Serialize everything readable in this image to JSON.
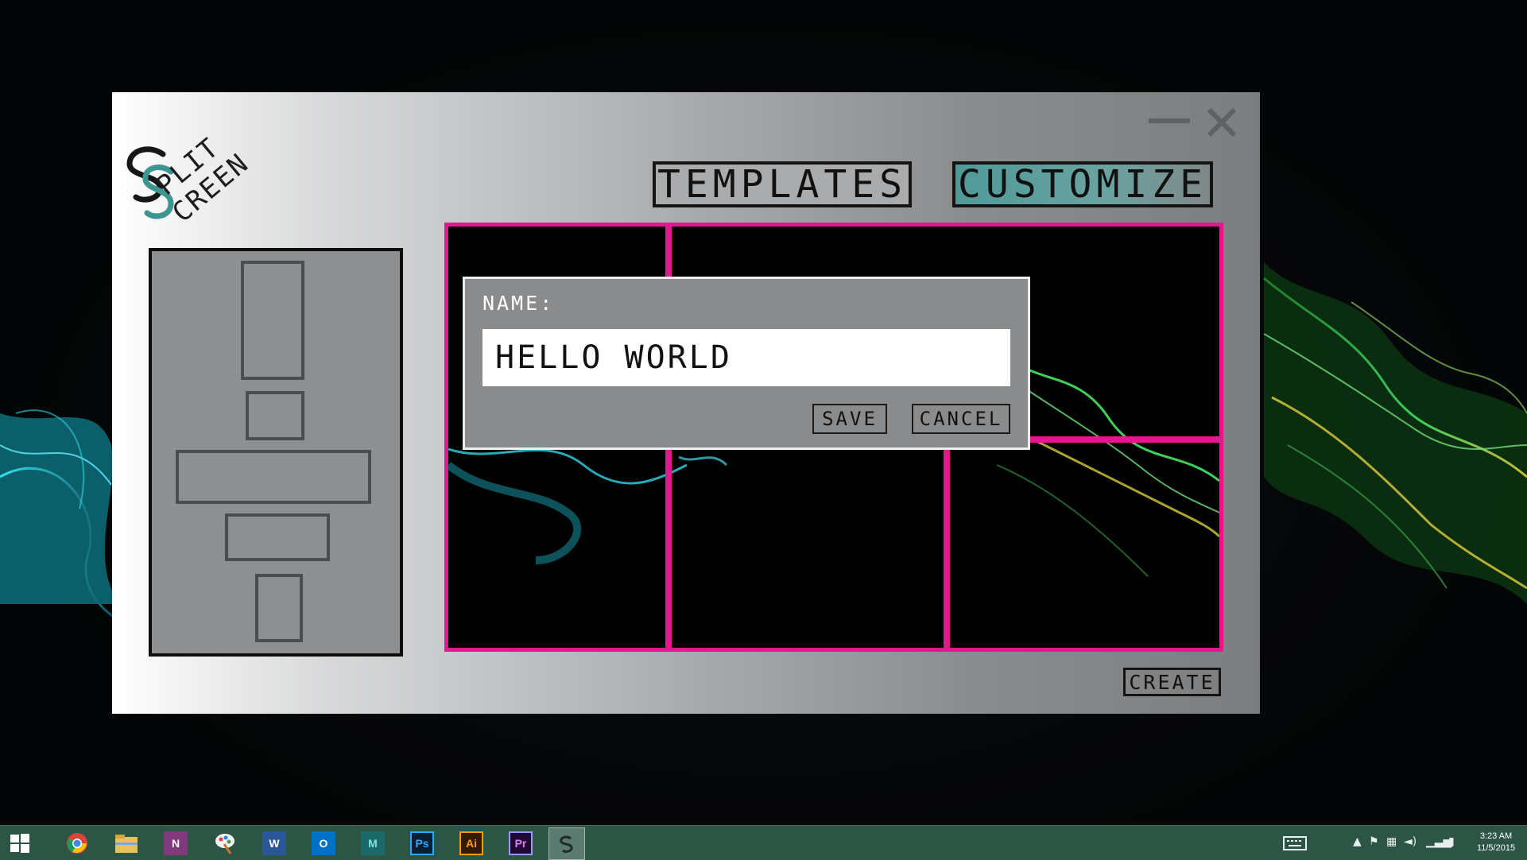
{
  "app": {
    "logo_words": [
      "PLIT",
      "CREEN"
    ],
    "tabs": [
      {
        "label": "TEMPLATES",
        "active": false
      },
      {
        "label": "CUSTOMIZE",
        "active": true
      }
    ],
    "create_label": "CREATE",
    "colors": {
      "accent_pink": "#e3178e",
      "accent_teal": "#4f9a98",
      "tab_border": "#141414"
    }
  },
  "dialog": {
    "name_label": "NAME:",
    "name_value": "HELLO WORLD",
    "save_label": "SAVE",
    "cancel_label": "CANCEL"
  },
  "taskbar": {
    "apps": [
      {
        "icon": "windows-start-icon"
      },
      {
        "icon": "chrome-icon"
      },
      {
        "icon": "file-explorer-icon"
      },
      {
        "icon": "onenote-icon",
        "glyph": "N"
      },
      {
        "icon": "paint-icon"
      },
      {
        "icon": "word-icon",
        "glyph": "W"
      },
      {
        "icon": "outlook-icon",
        "glyph": "O"
      },
      {
        "icon": "maya-icon",
        "glyph": "M"
      },
      {
        "icon": "photoshop-icon",
        "glyph": "Ps"
      },
      {
        "icon": "illustrator-icon",
        "glyph": "Ai"
      },
      {
        "icon": "premiere-icon",
        "glyph": "Pr"
      },
      {
        "icon": "split-screen-app-icon",
        "active": true
      }
    ],
    "time": "3:23 AM",
    "date": "11/5/2015"
  }
}
